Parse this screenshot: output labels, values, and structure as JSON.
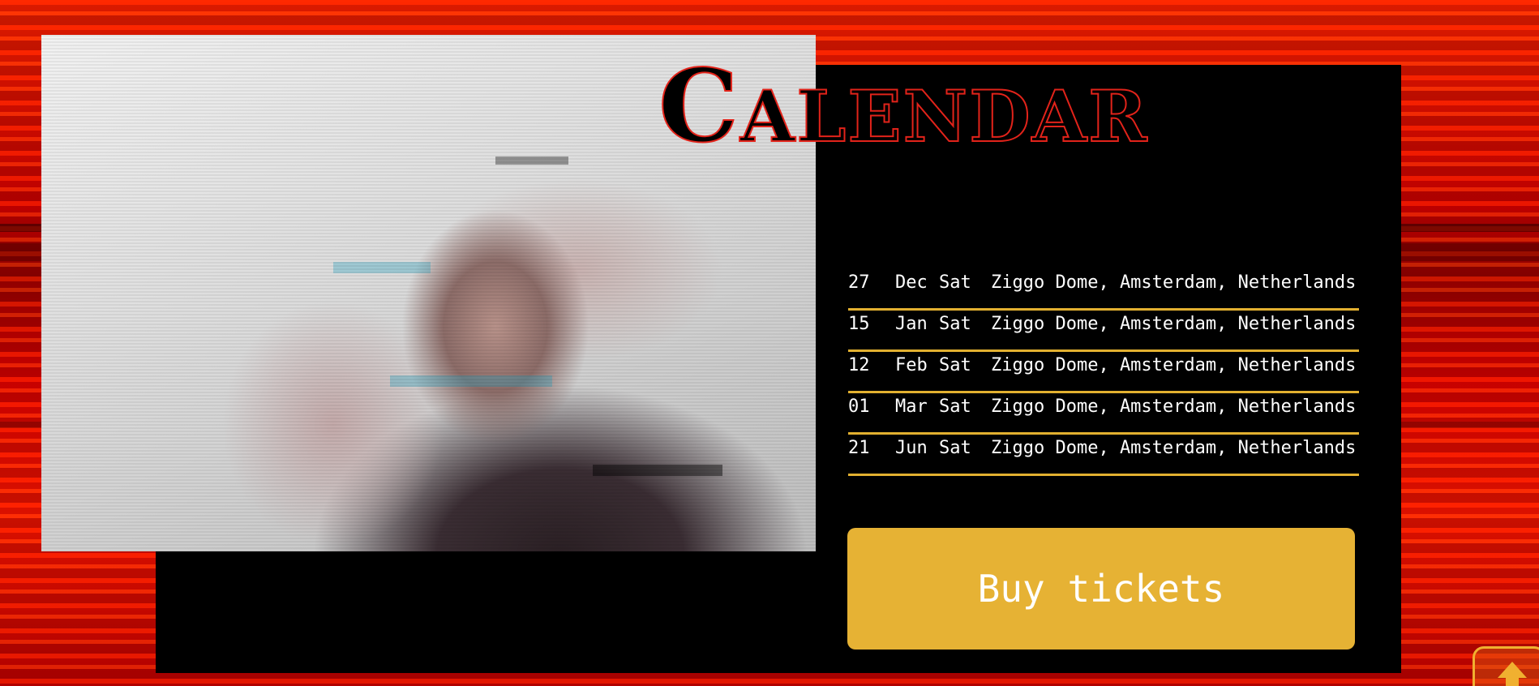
{
  "section": {
    "title": "Calendar"
  },
  "events": [
    {
      "day": "27",
      "month": "Dec",
      "weekday": "Sat",
      "venue": "Ziggo Dome, Amsterdam, Netherlands"
    },
    {
      "day": "15",
      "month": "Jan",
      "weekday": "Sat",
      "venue": "Ziggo Dome, Amsterdam, Netherlands"
    },
    {
      "day": "12",
      "month": "Feb",
      "weekday": "Sat",
      "venue": "Ziggo Dome, Amsterdam, Netherlands"
    },
    {
      "day": "01",
      "month": "Mar",
      "weekday": "Sat",
      "venue": "Ziggo Dome, Amsterdam, Netherlands"
    },
    {
      "day": "21",
      "month": "Jun",
      "weekday": "Sat",
      "venue": "Ziggo Dome, Amsterdam, Netherlands"
    }
  ],
  "cta": {
    "buy_label": "Buy tickets"
  },
  "icons": {
    "scroll_top": "arrow-up-icon"
  },
  "colors": {
    "accent": "#e6b234",
    "title_outline": "#e2231a",
    "panel": "#000000",
    "background": "#c00000"
  }
}
